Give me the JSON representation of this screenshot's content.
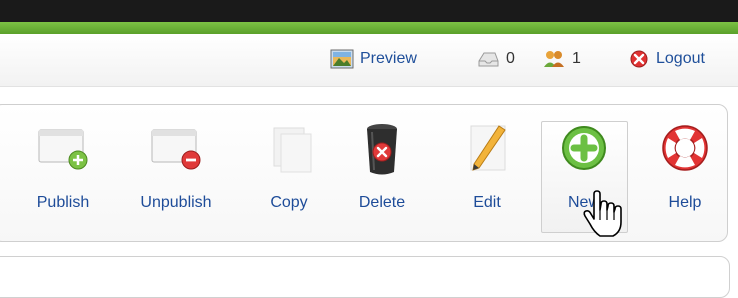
{
  "status": {
    "preview": "Preview",
    "messages_count": "0",
    "users_count": "1",
    "logout": "Logout"
  },
  "toolbar": {
    "publish": "Publish",
    "unpublish": "Unpublish",
    "copy": "Copy",
    "delete": "Delete",
    "edit": "Edit",
    "new": "New",
    "help": "Help"
  },
  "colors": {
    "header_dark": "#1a1a1a",
    "header_green": "#6ab136",
    "link_blue": "#1e4c99"
  }
}
